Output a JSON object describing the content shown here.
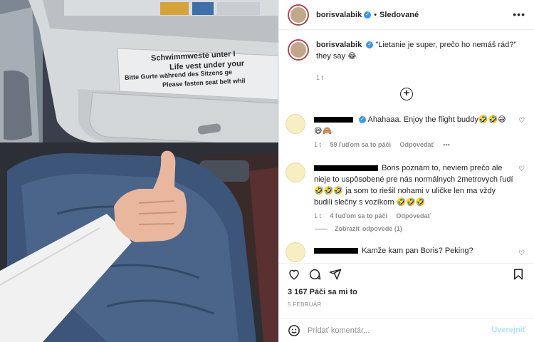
{
  "header": {
    "username": "borisvalabik",
    "verified_glyph": "✓",
    "separator": "•",
    "follow_status": "Sledované",
    "more_icon": "more-horizontal-icon",
    "more_glyph": "•••"
  },
  "photo": {
    "placard_line1": "Schwimmweste unter I",
    "placard_line2": "Life vest under your",
    "placard_line3": "Bitte Gurte während des Sitzens ge",
    "placard_line4": "Please fasten seat belt whil"
  },
  "caption": {
    "username": "borisvalabik",
    "text": "\"Lietanie je super, prečo ho nemáš rád?\" they say 😂",
    "time": "1 t"
  },
  "load_more_glyph": "+",
  "comments": [
    {
      "text": "Ahahaaa. Enjoy the flight buddy🤣🤣😅😅🙈",
      "time": "1 t",
      "likes": "59 ľuďom sa to páči",
      "reply": "Odpovedať",
      "more": "•••"
    },
    {
      "text": "Boris poznám to, neviem prečo ale nieje to uspôsobené pre nás normálnych 2metrovych ľudí 🤣🤣🤣 ja som to riešil nohami v uličke len ma vždy budili slečny s vozíkom 🤣🤣🤣",
      "time": "1 t",
      "likes": "4 ľuďom sa to páči",
      "reply": "Odpovedať",
      "view_replies": "Zobraziť odpovede (1)"
    },
    {
      "text": "Kamže kam pan Boris? Peking?"
    }
  ],
  "heart_glyph": "♡",
  "stats": {
    "likes": "3 167 Páči sa mi to",
    "date": "5 FEBRUÁR"
  },
  "add_comment": {
    "placeholder": "Pridať komentár...",
    "post_label": "Uverejniť"
  },
  "icons": [
    "heart-icon",
    "comment-icon",
    "share-icon",
    "bookmark-icon",
    "emoji-icon"
  ],
  "colors": {
    "verified": "#3897f0",
    "muted": "#8e8e8e",
    "post_disabled": "#b2dffc",
    "text": "#262626"
  }
}
